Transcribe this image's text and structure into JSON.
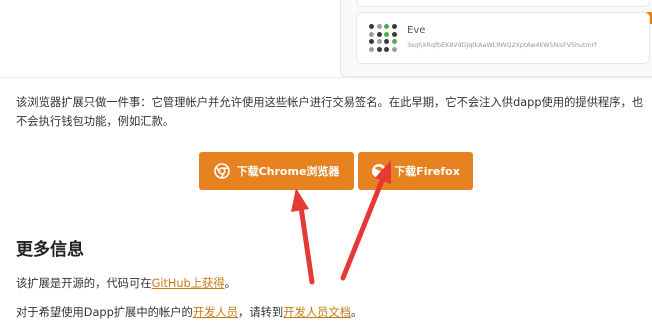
{
  "account_card": {
    "name": "Eve",
    "address": "3sqhXRqfbEK8VdDjqtkAaWLRWQ2XptAw4kW5NisFV5hutmrf"
  },
  "intro_text": "该浏览器扩展只做一件事：它管理帐户并允许使用这些帐户进行交易签名。在此早期，它不会注入供dapp使用的提供程序，也不会执行钱包功能，例如汇款。",
  "buttons": {
    "chrome": {
      "label": "下载Chrome浏览器",
      "icon": "chrome-icon"
    },
    "firefox": {
      "label": "下载Firefox",
      "icon": "firefox-icon"
    }
  },
  "more_info": {
    "heading": "更多信息",
    "p1_prefix": "该扩展是开源的，代码可在",
    "p1_link": "GitHub上获得",
    "p1_suffix": "。",
    "p2_prefix": "对于希望使用Dapp扩展中的帐户的",
    "p2_link1": "开发人员",
    "p2_middle": "，请转到",
    "p2_link2": "开发人员文档",
    "p2_suffix": "。"
  },
  "colors": {
    "button": "#e6821f",
    "link": "#c77a12",
    "annotation_arrow": "#e53935"
  }
}
